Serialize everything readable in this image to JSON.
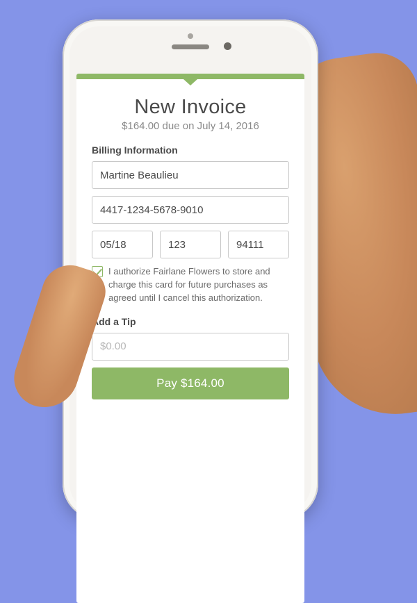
{
  "header": {
    "title": "New Invoice",
    "subtitle": "$164.00 due on July 14, 2016"
  },
  "billing": {
    "section_label": "Billing Information",
    "name": "Martine Beaulieu",
    "card_number": "4417-1234-5678-9010",
    "expiry": "05/18",
    "cvv": "123",
    "zip": "94111",
    "consent_text": "I authorize Fairlane Flowers to store and charge this card for future purchases as agreed until I cancel this authorization."
  },
  "tip": {
    "section_label": "Add a Tip",
    "placeholder": "$0.00"
  },
  "pay": {
    "label": "Pay $164.00"
  }
}
